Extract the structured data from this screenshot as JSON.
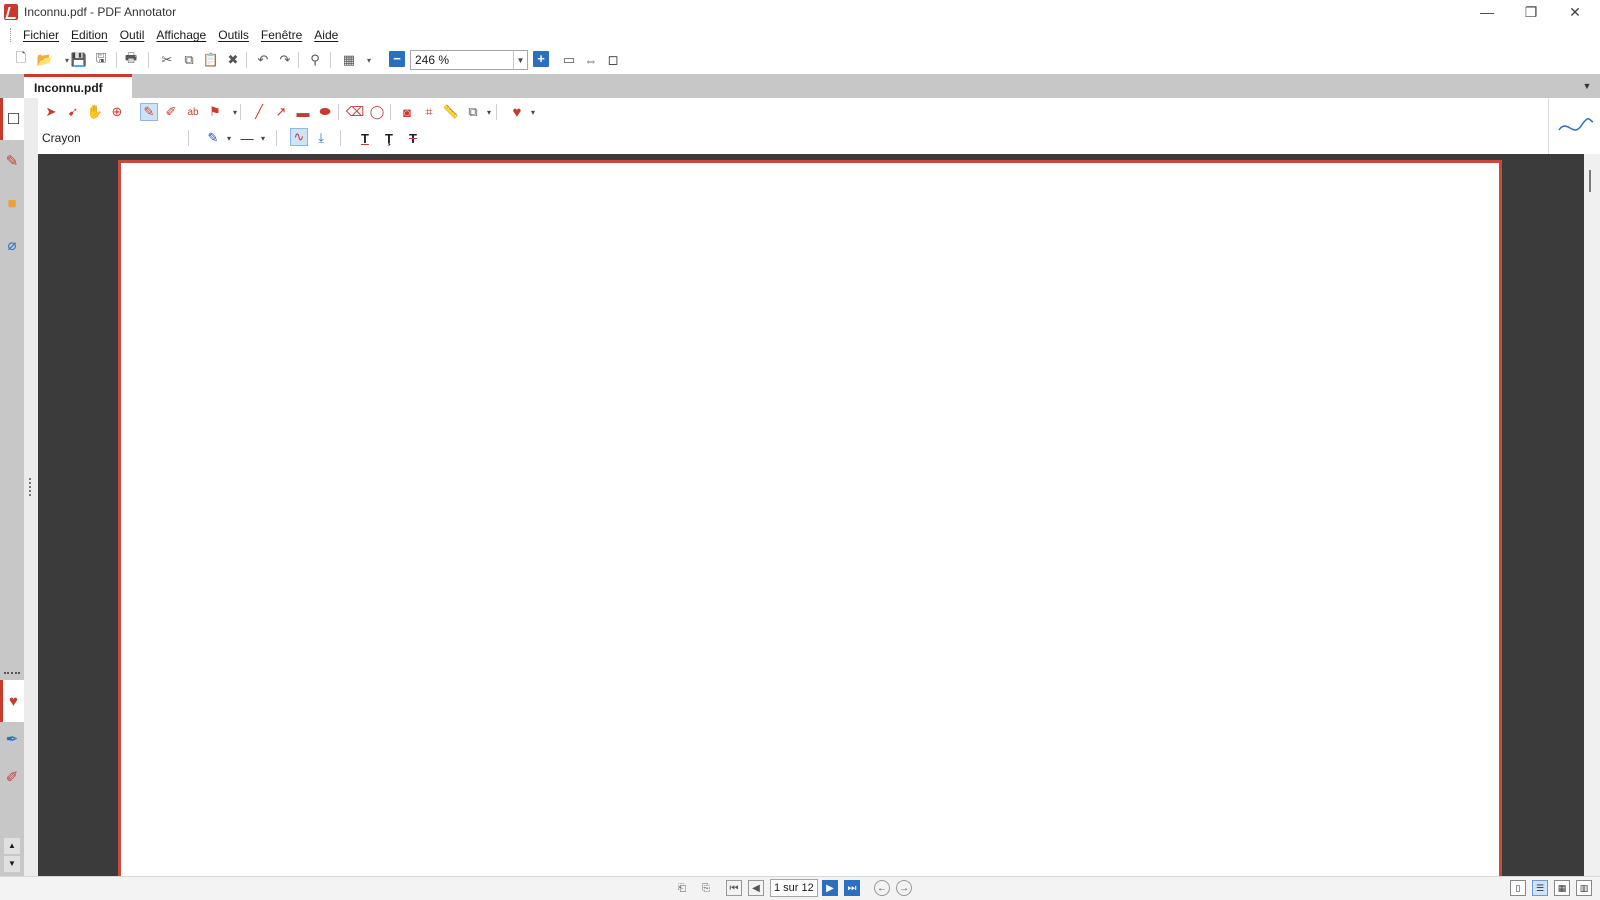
{
  "window": {
    "title": "Inconnu.pdf - PDF Annotator",
    "controls": {
      "minimize": "—",
      "restore": "❐",
      "close": "✕"
    }
  },
  "menubar": {
    "items": [
      "Fichier",
      "Edition",
      "Outil",
      "Affichage",
      "Outils",
      "Fenêtre",
      "Aide"
    ]
  },
  "toolbar": {
    "zoom_value": "246 %",
    "zoom_out": "−",
    "zoom_in": "+"
  },
  "tabs": {
    "active_tab": "Inconnu.pdf"
  },
  "tool_panel": {
    "current_tool_label": "Crayon"
  },
  "status": {
    "page_indicator": "1 sur 12"
  },
  "colors": {
    "accent": "#c63b2e",
    "page_border": "#c94a3a",
    "doc_background": "#3b3b3b",
    "button_blue": "#2c6fbf"
  }
}
